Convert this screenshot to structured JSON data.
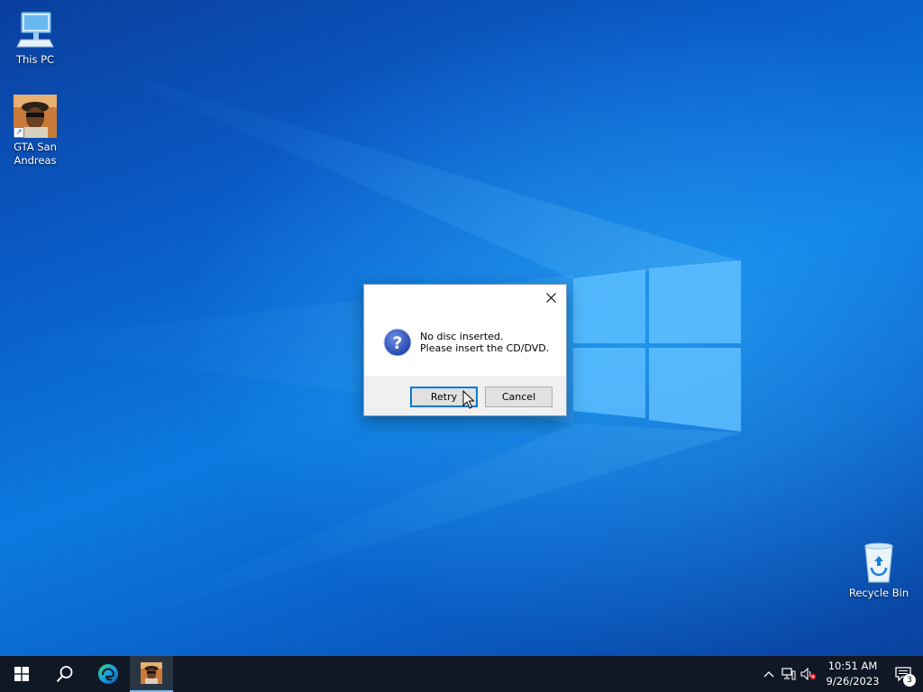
{
  "desktop": {
    "icons": [
      {
        "label": "This PC",
        "icon": "computer-icon"
      },
      {
        "label": "GTA San Andreas",
        "icon": "gta-san-andreas-icon"
      },
      {
        "label": "Recycle Bin",
        "icon": "recycle-bin-icon"
      }
    ]
  },
  "dialog": {
    "line1": "No disc inserted.",
    "line2": "Please insert the CD/DVD.",
    "icon": "question-icon",
    "retry_label": "Retry",
    "cancel_label": "Cancel"
  },
  "taskbar": {
    "clock_time": "10:51 AM",
    "clock_date": "9/26/2023",
    "notification_count": "3",
    "pinned": [
      "start-icon",
      "search-icon",
      "edge-icon",
      "gta-san-andreas-icon"
    ]
  },
  "colors": {
    "accent": "#0078d7",
    "taskbar": "#101826",
    "desktop": "#0b7ae0"
  }
}
